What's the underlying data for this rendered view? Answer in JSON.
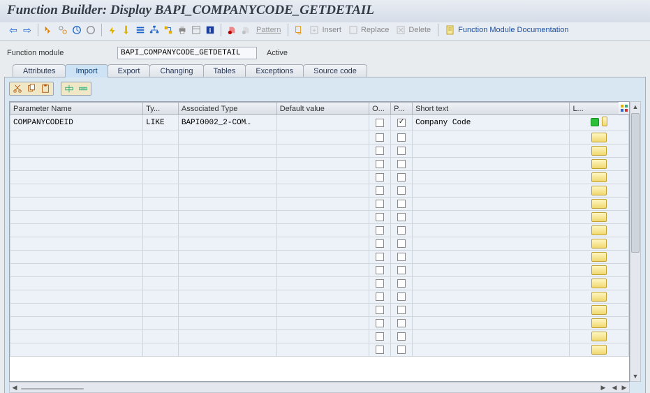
{
  "window": {
    "title": "Function Builder: Display BAPI_COMPANYCODE_GETDETAIL"
  },
  "toolbar": {
    "pattern_label": "Pattern",
    "insert_label": "Insert",
    "replace_label": "Replace",
    "delete_label": "Delete",
    "doc_label": "Function Module Documentation"
  },
  "form": {
    "module_label": "Function module",
    "module_value": "BAPI_COMPANYCODE_GETDETAIL",
    "status": "Active"
  },
  "tabs": {
    "attributes": "Attributes",
    "import": "Import",
    "export": "Export",
    "changing": "Changing",
    "tables": "Tables",
    "exceptions": "Exceptions",
    "source": "Source code",
    "active": "import"
  },
  "grid": {
    "columns": {
      "param": "Parameter Name",
      "type": "Ty...",
      "assoc": "Associated Type",
      "def": "Default value",
      "o": "O...",
      "p": "P...",
      "short": "Short text",
      "l": "L..."
    },
    "rows": [
      {
        "param": "COMPANYCODEID",
        "type": "LIKE",
        "assoc": "BAPI0002_2-COM…",
        "def": "",
        "o": false,
        "p": true,
        "short": "Company Code",
        "l": "green"
      }
    ],
    "empty_row_count": 17
  }
}
